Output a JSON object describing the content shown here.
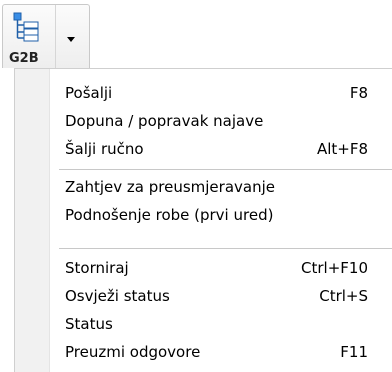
{
  "toolbar": {
    "button_label": "G2B",
    "icon": "tree-icon"
  },
  "menu": {
    "groups": [
      [
        {
          "label": "Pošalji",
          "shortcut": "F8"
        },
        {
          "label": "Dopuna / popravak najave",
          "shortcut": ""
        },
        {
          "label": "Šalji ručno",
          "shortcut": "Alt+F8"
        }
      ],
      [
        {
          "label": "Zahtjev za preusmjeravanje",
          "shortcut": ""
        },
        {
          "label": "Podnošenje robe (prvi ured)",
          "shortcut": ""
        }
      ],
      [
        {
          "label": "Storniraj",
          "shortcut": "Ctrl+F10"
        },
        {
          "label": "Osvježi status",
          "shortcut": "Ctrl+S"
        },
        {
          "label": "Status",
          "shortcut": ""
        },
        {
          "label": "Preuzmi odgovore",
          "shortcut": "F11"
        }
      ]
    ]
  }
}
